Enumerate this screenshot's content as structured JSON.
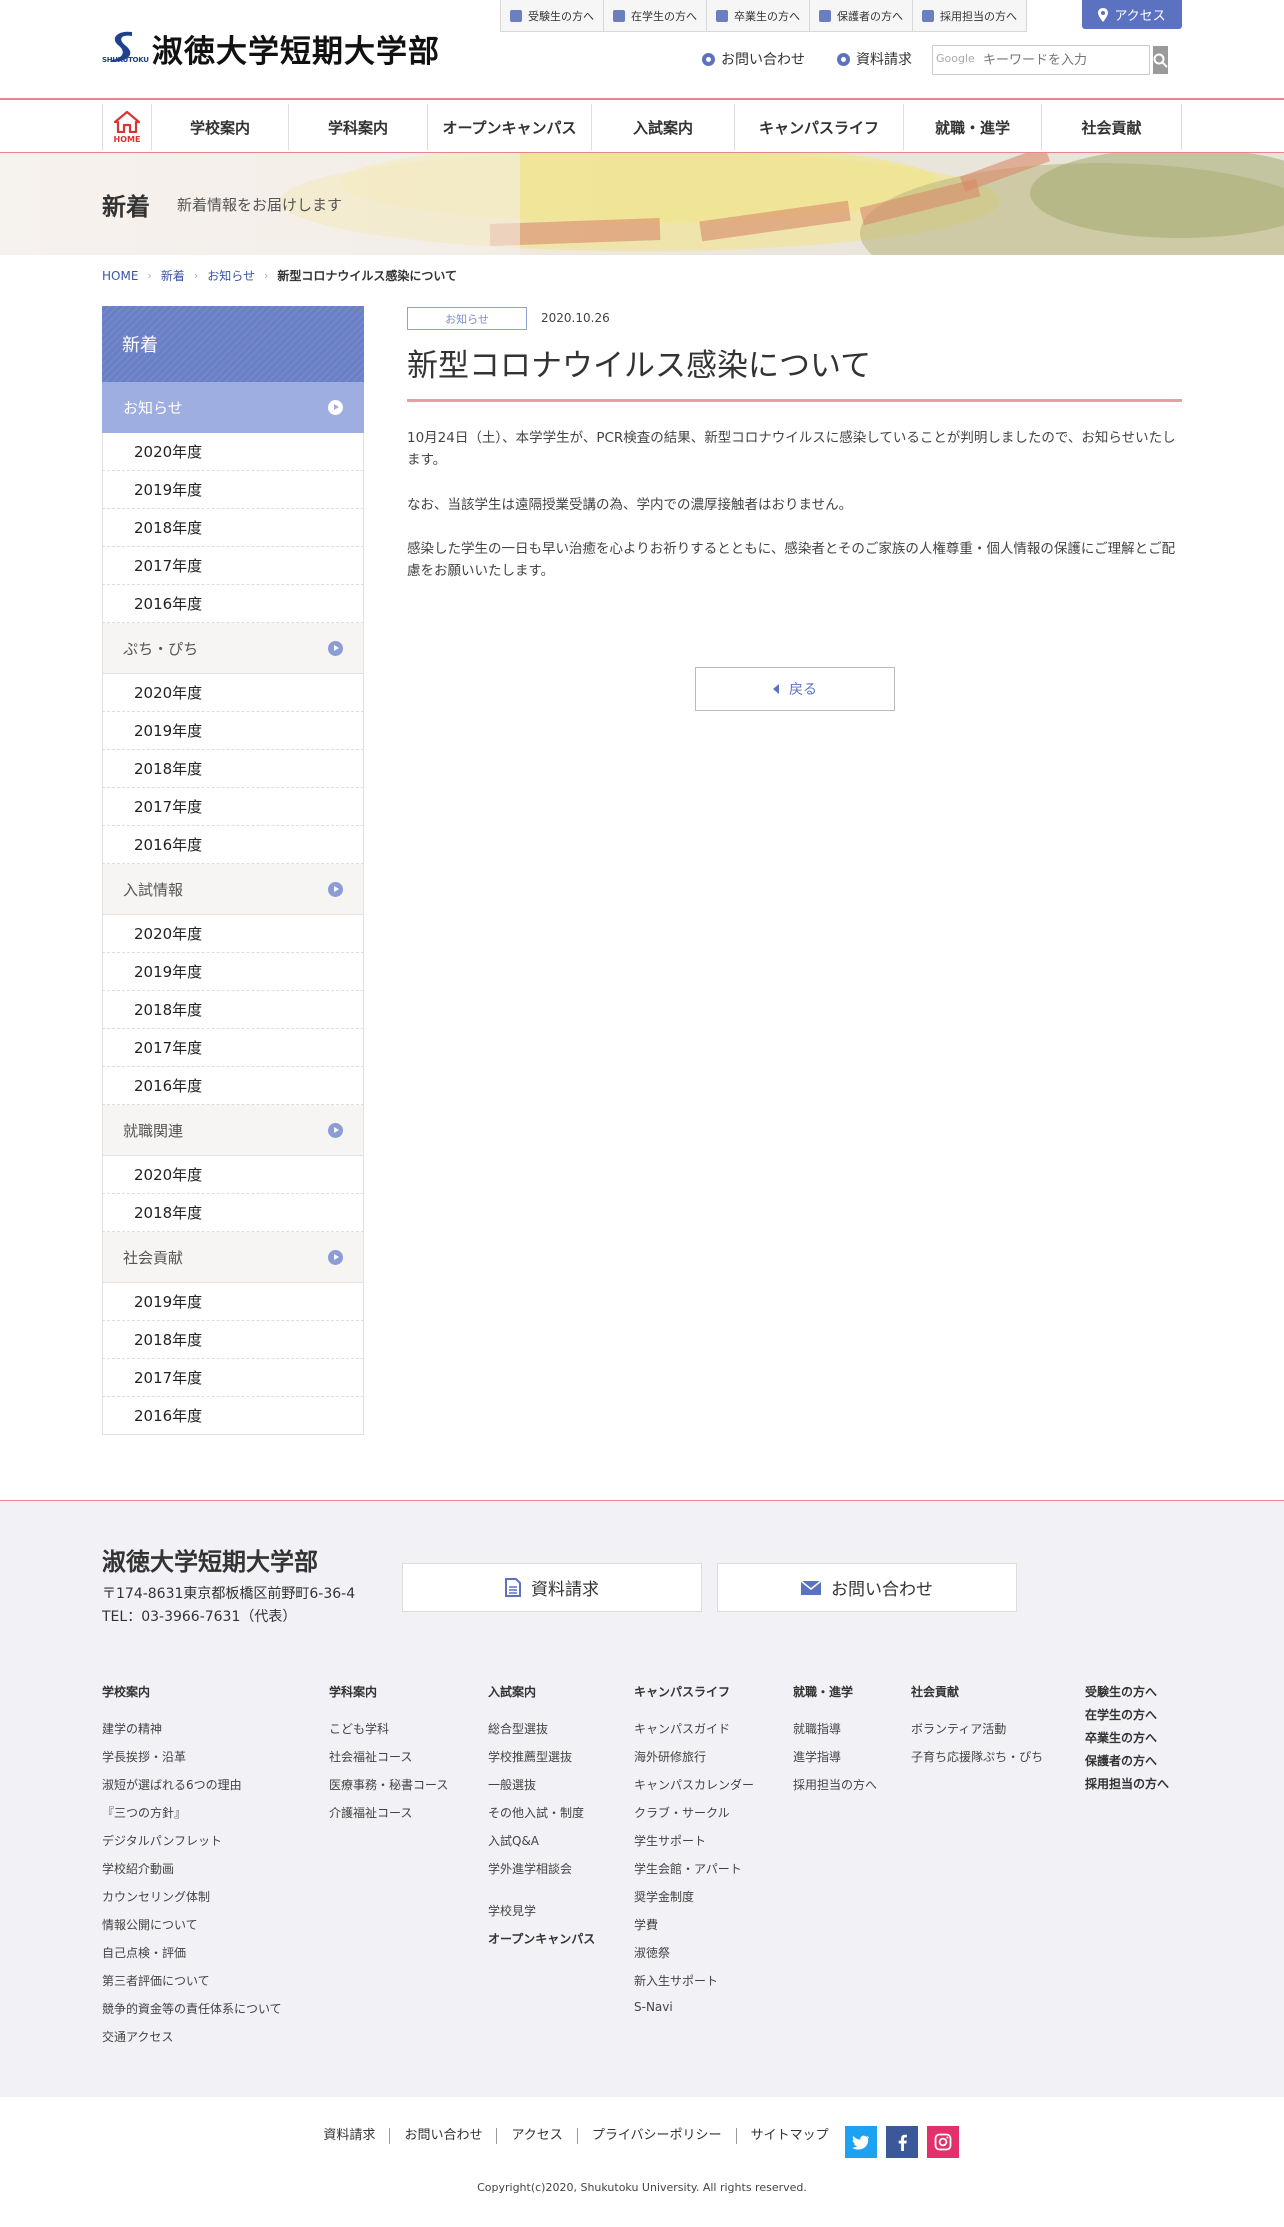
{
  "header": {
    "logo_name": "淑徳大学短期大学部",
    "logo_sub": "SHUKUTOKU",
    "audience_links": [
      "受験生の方へ",
      "在学生の方へ",
      "卒業生の方へ",
      "保護者の方へ",
      "採用担当の方へ"
    ],
    "access_label": "アクセス",
    "contact_label": "お問い合わせ",
    "request_label": "資料請求",
    "search_provider": "Google",
    "search_placeholder": "キーワードを入力"
  },
  "nav": {
    "home_label": "HOME",
    "items": [
      "学校案内",
      "学科案内",
      "オープンキャンパス",
      "入試案内",
      "キャンパスライフ",
      "就職・進学",
      "社会貢献"
    ]
  },
  "banner": {
    "title": "新着",
    "subtitle": "新着情報をお届けします"
  },
  "breadcrumb": [
    "HOME",
    "新着",
    "お知らせ",
    "新型コロナウイルス感染について"
  ],
  "sidebar": {
    "title": "新着",
    "categories": [
      {
        "label": "お知らせ",
        "years": [
          "2020年度",
          "2019年度",
          "2018年度",
          "2017年度",
          "2016年度"
        ]
      },
      {
        "label": "ぷち・ぴち",
        "years": [
          "2020年度",
          "2019年度",
          "2018年度",
          "2017年度",
          "2016年度"
        ]
      },
      {
        "label": "入試情報",
        "years": [
          "2020年度",
          "2019年度",
          "2018年度",
          "2017年度",
          "2016年度"
        ]
      },
      {
        "label": "就職関連",
        "years": [
          "2020年度",
          "2018年度"
        ]
      },
      {
        "label": "社会貢献",
        "years": [
          "2019年度",
          "2018年度",
          "2017年度",
          "2016年度"
        ]
      }
    ]
  },
  "article": {
    "tag": "お知らせ",
    "date": "2020.10.26",
    "title": "新型コロナウイルス感染について",
    "paragraphs": [
      "10月24日（土）、本学学生が、PCR検査の結果、新型コロナウイルスに感染していることが判明しましたので、お知らせいたします。",
      "なお、当該学生は遠隔授業受講の為、学内での濃厚接触者はおりません。",
      "感染した学生の一日も早い治癒を心よりお祈りするとともに、感染者とそのご家族の人権尊重・個人情報の保護にご理解とご配慮をお願いいたします。"
    ],
    "back_label": "戻る"
  },
  "footer": {
    "name": "淑徳大学短期大学部",
    "address": "〒174-8631東京都板橋区前野町6-36-4",
    "tel": "TEL：03-3966-7631（代表）",
    "request_button": "資料請求",
    "contact_button": "お問い合わせ",
    "columns": [
      {
        "heading": "学校案内",
        "items": [
          "建学の精神",
          "学長挨拶・沿革",
          "淑短が選ばれる6つの理由",
          "『三つの方針』",
          "デジタルパンフレット",
          "学校紹介動画",
          "カウンセリング体制",
          "情報公開について",
          "自己点検・評価",
          "第三者評価について",
          "競争的資金等の責任体系について",
          "交通アクセス"
        ]
      },
      {
        "heading": "学科案内",
        "items": [
          "こども学科",
          "社会福祉コース",
          "医療事務・秘書コース",
          "介護福祉コース"
        ]
      },
      {
        "heading": "入試案内",
        "items": [
          "総合型選抜",
          "学校推薦型選抜",
          "一般選抜",
          "その他入試・制度",
          "入試Q&A",
          "学外進学相談会"
        ],
        "extra": "学校見学",
        "extra_bold": "オープンキャンパス"
      },
      {
        "heading": "キャンパスライフ",
        "items": [
          "キャンパスガイド",
          "海外研修旅行",
          "キャンパスカレンダー",
          "クラブ・サークル",
          "学生サポート",
          "学生会館・アパート",
          "奨学金制度",
          "学費",
          "淑徳祭",
          "新入生サポート",
          "S-Navi"
        ]
      },
      {
        "heading": "就職・進学",
        "items": [
          "就職指導",
          "進学指導",
          "採用担当の方へ"
        ]
      },
      {
        "heading": "社会貢献",
        "items": [
          "ボランティア活動",
          "子育ち応援隊ぷち・ぴち"
        ]
      }
    ],
    "audience": [
      "受験生の方へ",
      "在学生の方へ",
      "卒業生の方へ",
      "保護者の方へ",
      "採用担当の方へ"
    ],
    "bottom_links": [
      "資料請求",
      "お問い合わせ",
      "アクセス",
      "プライバシーポリシー",
      "サイトマップ"
    ],
    "copyright": "Copyright(c)2020, Shukutoku University. All rights reserved."
  },
  "colors": {
    "accent": "#5b72c0",
    "rule": "#e5878d",
    "twitter": "#1da1f2",
    "facebook": "#3b5998",
    "instagram": "#e1306c"
  }
}
